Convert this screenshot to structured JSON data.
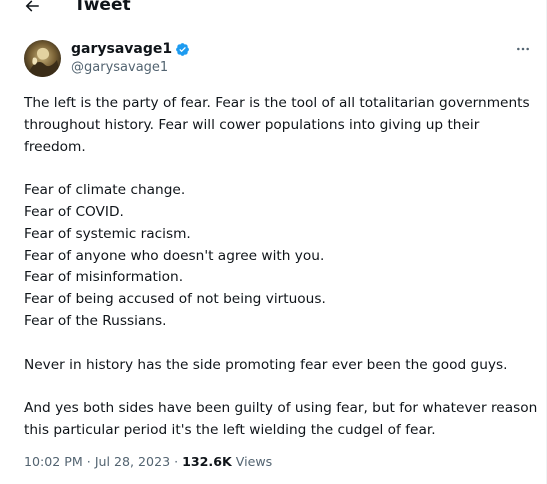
{
  "header": {
    "back_icon": "arrow-left-icon",
    "title": "Tweet"
  },
  "author": {
    "display_name": "garysavage1",
    "handle": "@garysavage1",
    "verified": true,
    "verified_icon": "verified-badge-icon",
    "verified_color": "#1d9bf0",
    "avatar": "avatar-photo"
  },
  "more_icon": "more-horizontal-icon",
  "tweet": {
    "paragraphs": [
      "The left is the party of fear. Fear is the tool of all totalitarian governments throughout history. Fear will cower populations into giving up their freedom.",
      "",
      "Fear of climate change.",
      "Fear of COVID.",
      "Fear of systemic racism.",
      "Fear of anyone who doesn't agree with you.",
      "Fear of misinformation.",
      "Fear of being accused of not being virtuous.",
      "Fear of the Russians.",
      "",
      "Never in history has the side promoting fear ever been the good guys.",
      "",
      "And yes both sides have been guilty of using fear, but for whatever reason this particular period it's the left wielding the cudgel of fear."
    ]
  },
  "meta": {
    "time": "10:02 PM",
    "separator": "·",
    "date": "Jul 28, 2023",
    "views_count": "132.6K",
    "views_label": "Views"
  },
  "colors": {
    "text": "#0f1419",
    "secondary": "#536471",
    "accent": "#1d9bf0",
    "border": "#eff3f4"
  }
}
